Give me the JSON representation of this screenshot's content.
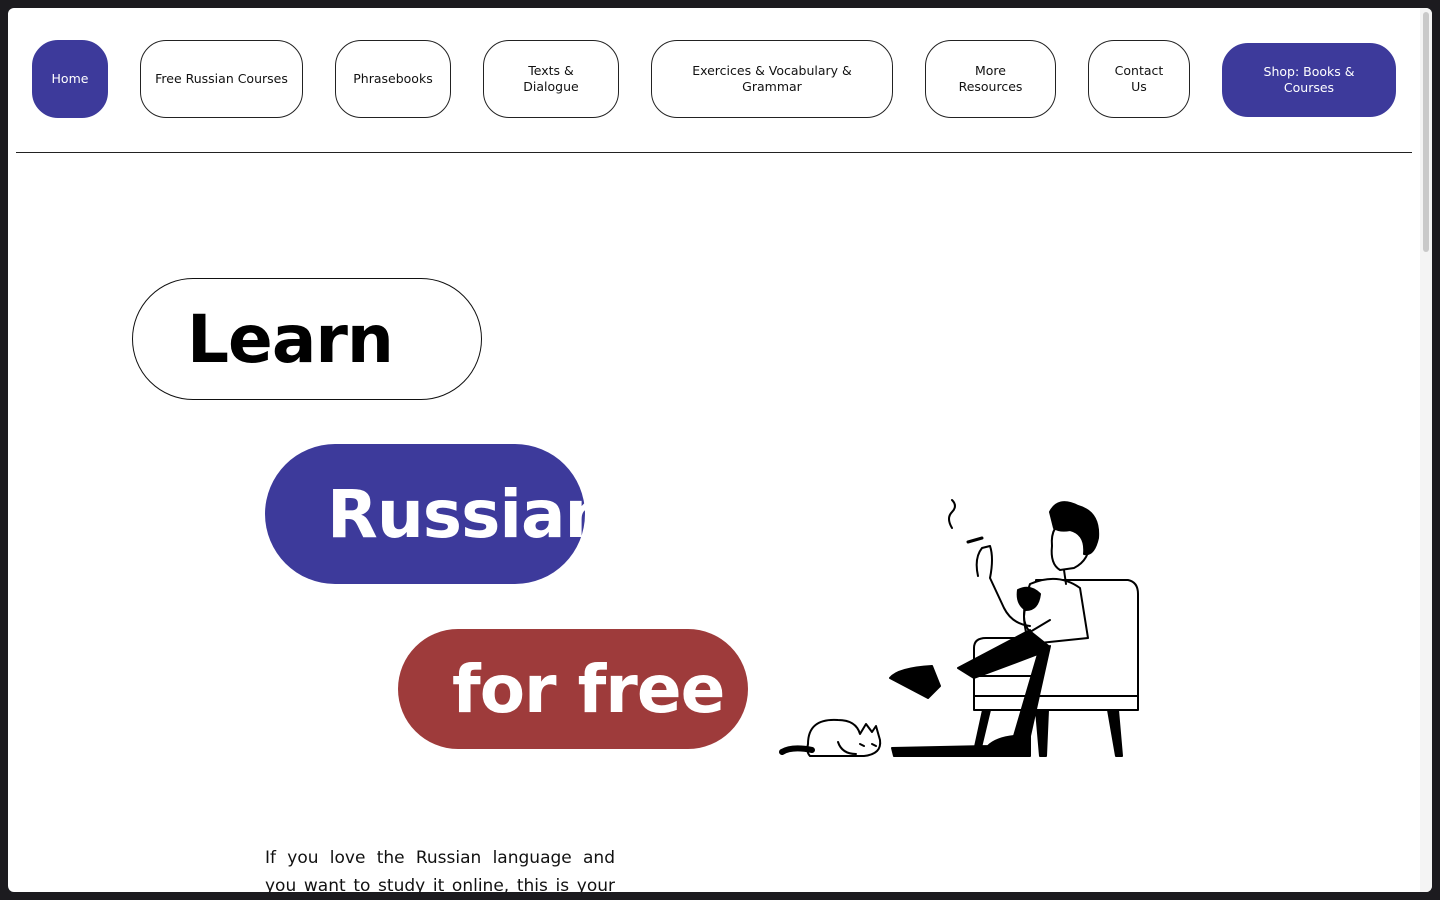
{
  "nav": {
    "items": [
      {
        "label": "Home"
      },
      {
        "label": "Free Russian Courses"
      },
      {
        "label": "Phrasebooks"
      },
      {
        "label": "Texts & Dialogue"
      },
      {
        "label": "Exercices & Vocabulary & Grammar"
      },
      {
        "label": "More Resources"
      },
      {
        "label": "Contact Us"
      },
      {
        "label": "Shop: Books & Courses"
      }
    ]
  },
  "hero": {
    "word1": "Learn",
    "word2": "Russian",
    "word3": "for free",
    "intro": "If you love the Russian language and you want to study it online, this is your place:"
  },
  "colors": {
    "primary": "#3d3a9b",
    "accent": "#9e3b3b"
  }
}
